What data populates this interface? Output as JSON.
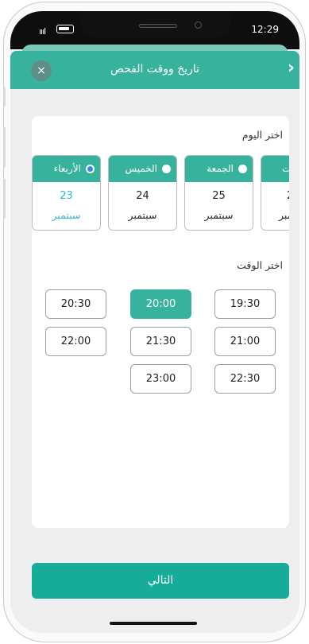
{
  "status_bar": {
    "time": "12:29",
    "signal": "ıııl"
  },
  "header": {
    "title": "تاريخ ووقت الفحص",
    "close_icon": "×",
    "back_icon": "›"
  },
  "day_section": {
    "label": "اختر اليوم"
  },
  "days": [
    {
      "name": "الأربعاء",
      "number": "23",
      "month": "سبتمبر",
      "selected": true
    },
    {
      "name": "الخميس",
      "number": "24",
      "month": "سبتمبر",
      "selected": false
    },
    {
      "name": "الجمعة",
      "number": "25",
      "month": "سبتمبر",
      "selected": false
    },
    {
      "name": "ت",
      "number": "2",
      "month": "سبتمبر",
      "selected": false
    }
  ],
  "time_section": {
    "label": "اختر الوقت"
  },
  "times": {
    "col_left": [
      "20:30",
      "22:00"
    ],
    "col_mid": [
      "20:00",
      "21:30",
      "23:00"
    ],
    "col_right": [
      "19:30",
      "21:00",
      "22:30"
    ],
    "selected": "20:00"
  },
  "next_button": {
    "label": "التالي"
  },
  "colors": {
    "primary": "#37b39d",
    "selected_day_text": "#33b5d5",
    "radio_selected": "#2d8fd8"
  }
}
